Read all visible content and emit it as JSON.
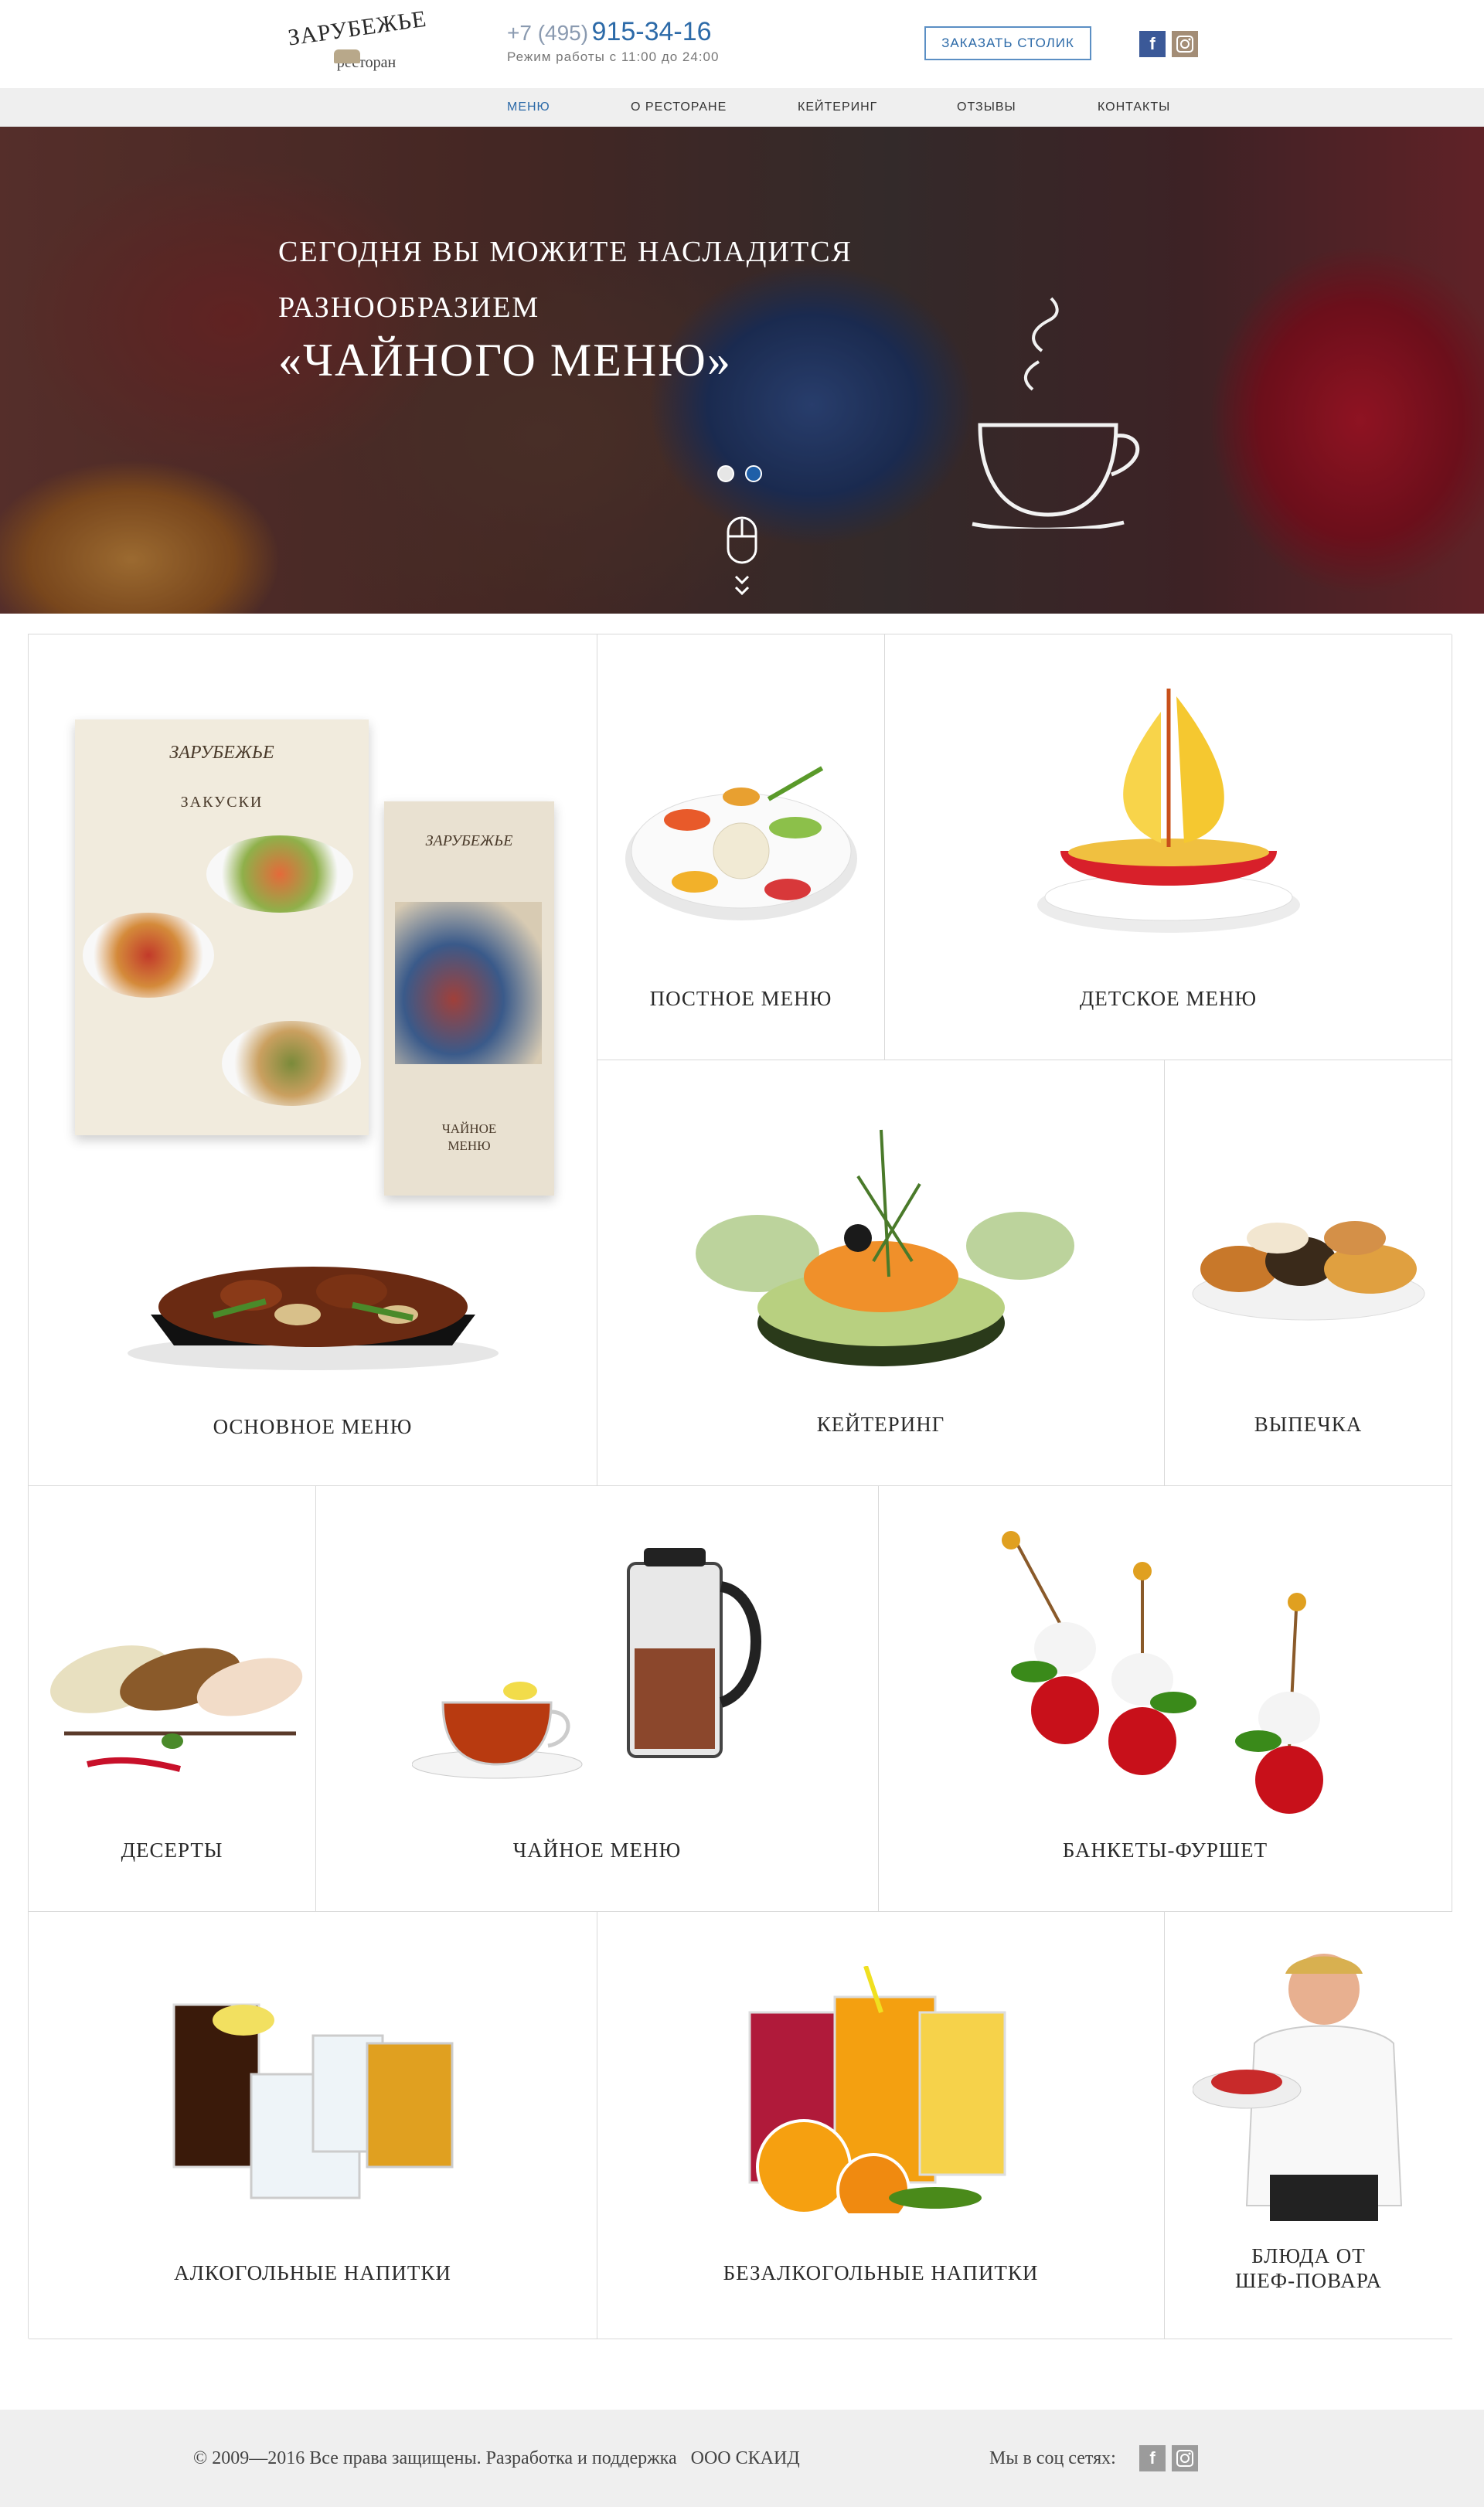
{
  "header": {
    "logo_name": "ЗАРУБЕЖЬЕ",
    "logo_sub": "ресторан",
    "phone_code": "+7 (495)",
    "phone_number": "915-34-16",
    "hours": "Режим работы с 11:00 до 24:00",
    "reserve_label": "ЗАКАЗАТЬ СТОЛИК"
  },
  "nav": {
    "items": [
      {
        "label": "МЕНЮ"
      },
      {
        "label": "О РЕСТОРАНЕ"
      },
      {
        "label": "КЕЙТЕРИНГ"
      },
      {
        "label": "ОТЗЫВЫ"
      },
      {
        "label": "КОНТАКТЫ"
      }
    ]
  },
  "hero": {
    "line1": "СЕГОДНЯ  ВЫ МОЖИТЕ НАСЛАДИТСЯ",
    "line2": "РАЗНООБРАЗИЕМ",
    "line3": "«ЧАЙНОГО МЕНЮ»"
  },
  "menu_tiles": {
    "main": "ОСНОВНОЕ МЕНЮ",
    "lenten": "ПОСТНОЕ МЕНЮ",
    "kids": "ДЕТСКОЕ МЕНЮ",
    "catering": "КЕЙТЕРИНГ",
    "bakery": "ВЫПЕЧКА",
    "desserts": "ДЕСЕРТЫ",
    "tea": "ЧАЙНОЕ МЕНЮ",
    "banquet": "БАНКЕТЫ-ФУРШЕТ",
    "alcohol": "АЛКОГОЛЬНЫЕ  НАПИТКИ",
    "soft": "БЕЗАЛКОГОЛЬНЫЕ  НАПИТКИ",
    "chef_line1": "БЛЮДА ОТ",
    "chef_line2": "ШЕФ-ПОВАРА"
  },
  "menu_booklet": {
    "brand": "ЗАРУБЕЖЬЕ",
    "section": "ЗАКУСКИ",
    "cover_title_1": "ЧАЙНОЕ",
    "cover_title_2": "МЕНЮ"
  },
  "footer": {
    "copyright": "© 2009—2016  Все права защищены.  Разработка и поддержка",
    "company": "ООО СКАИД",
    "social_label": "Мы в соц сетях:"
  },
  "colors": {
    "accent": "#2c6aa8",
    "nav_bg": "#efefef",
    "facebook": "#3b5998",
    "slider_active": "#1f5fa8"
  },
  "icons": {
    "facebook": "facebook-icon",
    "instagram": "instagram-icon",
    "scroll": "mouse-scroll-icon",
    "teacup": "teacup-icon"
  }
}
